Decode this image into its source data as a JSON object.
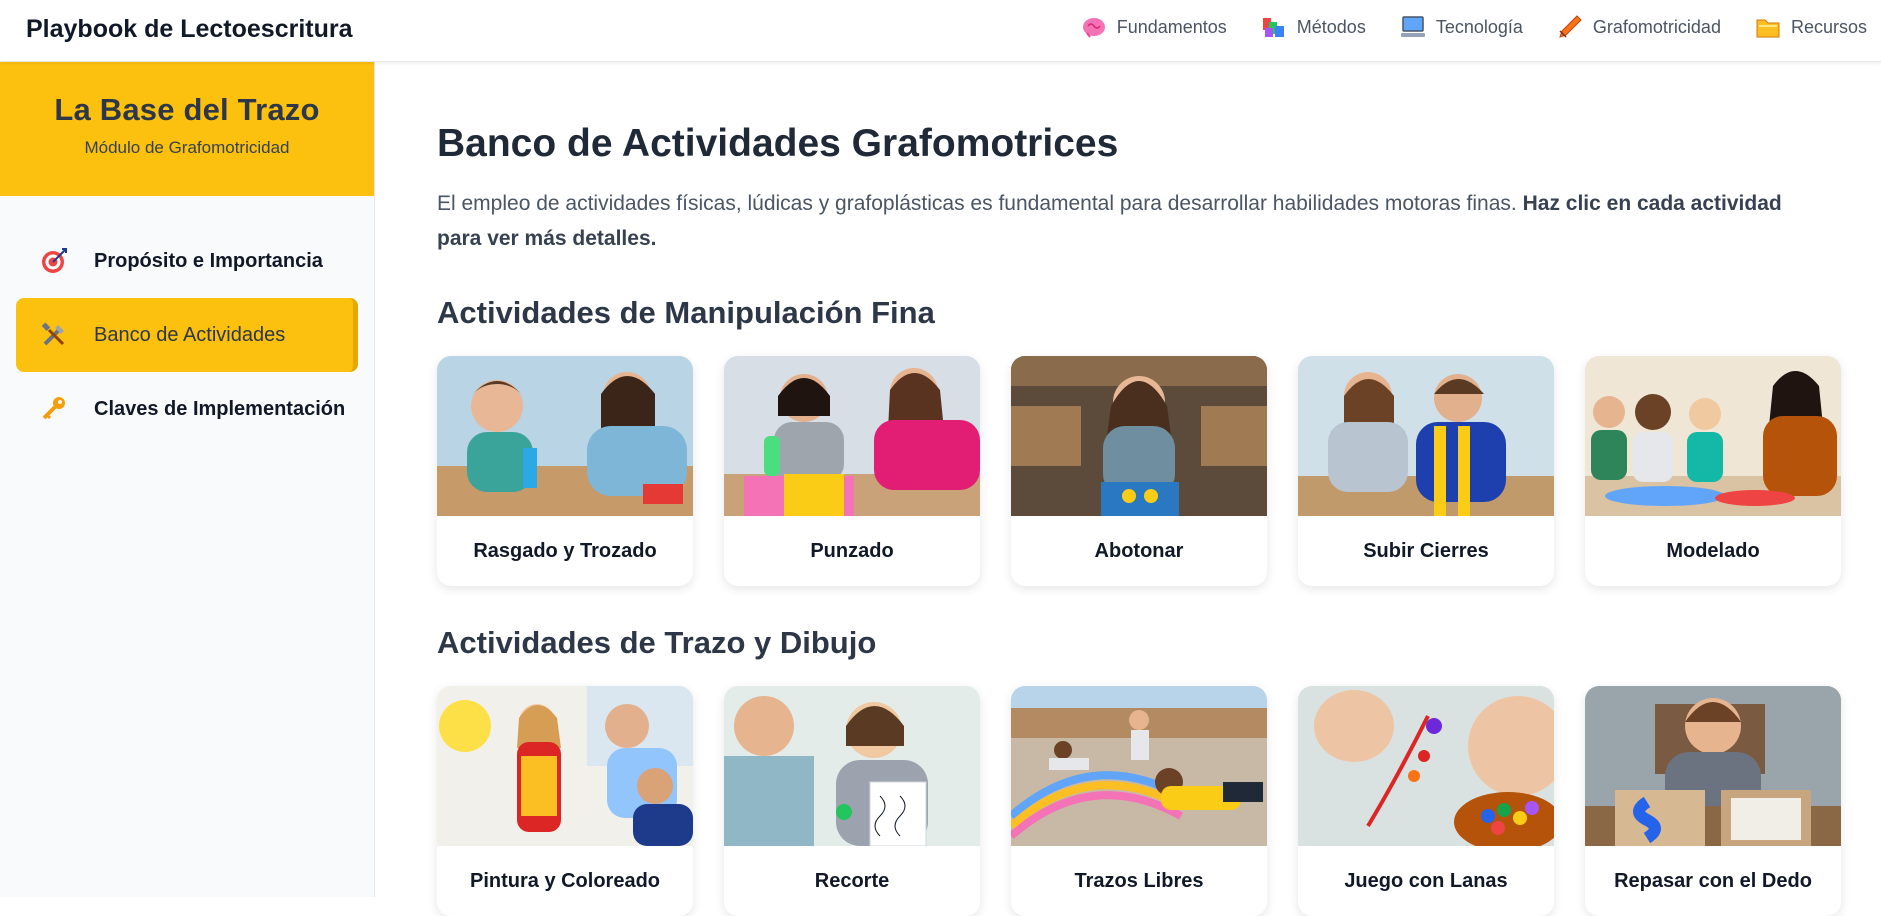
{
  "topbar": {
    "brand": "Playbook de Lectoescritura",
    "nav": [
      {
        "label": "Fundamentos",
        "icon": "brain-icon"
      },
      {
        "label": "Métodos",
        "icon": "books-icon"
      },
      {
        "label": "Tecnología",
        "icon": "computer-icon"
      },
      {
        "label": "Grafomotricidad",
        "icon": "pencil-icon"
      },
      {
        "label": "Recursos",
        "icon": "folder-icon"
      }
    ]
  },
  "sidebar": {
    "title": "La Base del Trazo",
    "subtitle": "Módulo de Grafomotricidad",
    "items": [
      {
        "label": "Propósito e Importancia",
        "icon": "target-icon"
      },
      {
        "label": "Banco de Actividades",
        "icon": "tools-icon",
        "active": true
      },
      {
        "label": "Claves de Implementación",
        "icon": "key-icon"
      }
    ]
  },
  "main": {
    "title": "Banco de Actividades Grafomotrices",
    "intro": "El empleo de actividades físicas, lúdicas y grafoplásticas es fundamental para desarrollar habilidades motoras finas.",
    "intro_bold": "Haz clic en cada actividad para ver más detalles.",
    "sections": [
      {
        "title": "Actividades de Manipulación Fina",
        "cards": [
          "Rasgado y Trozado",
          "Punzado",
          "Abotonar",
          "Subir Cierres",
          "Modelado"
        ]
      },
      {
        "title": "Actividades de Trazo y Dibujo",
        "cards": [
          "Pintura y Coloreado",
          "Recorte",
          "Trazos Libres",
          "Juego con Lanas",
          "Repasar con el Dedo"
        ]
      }
    ]
  },
  "colors": {
    "accent": "#fcc10e",
    "sidebar_bg": "#f9fafb",
    "heading": "#1f2937"
  }
}
